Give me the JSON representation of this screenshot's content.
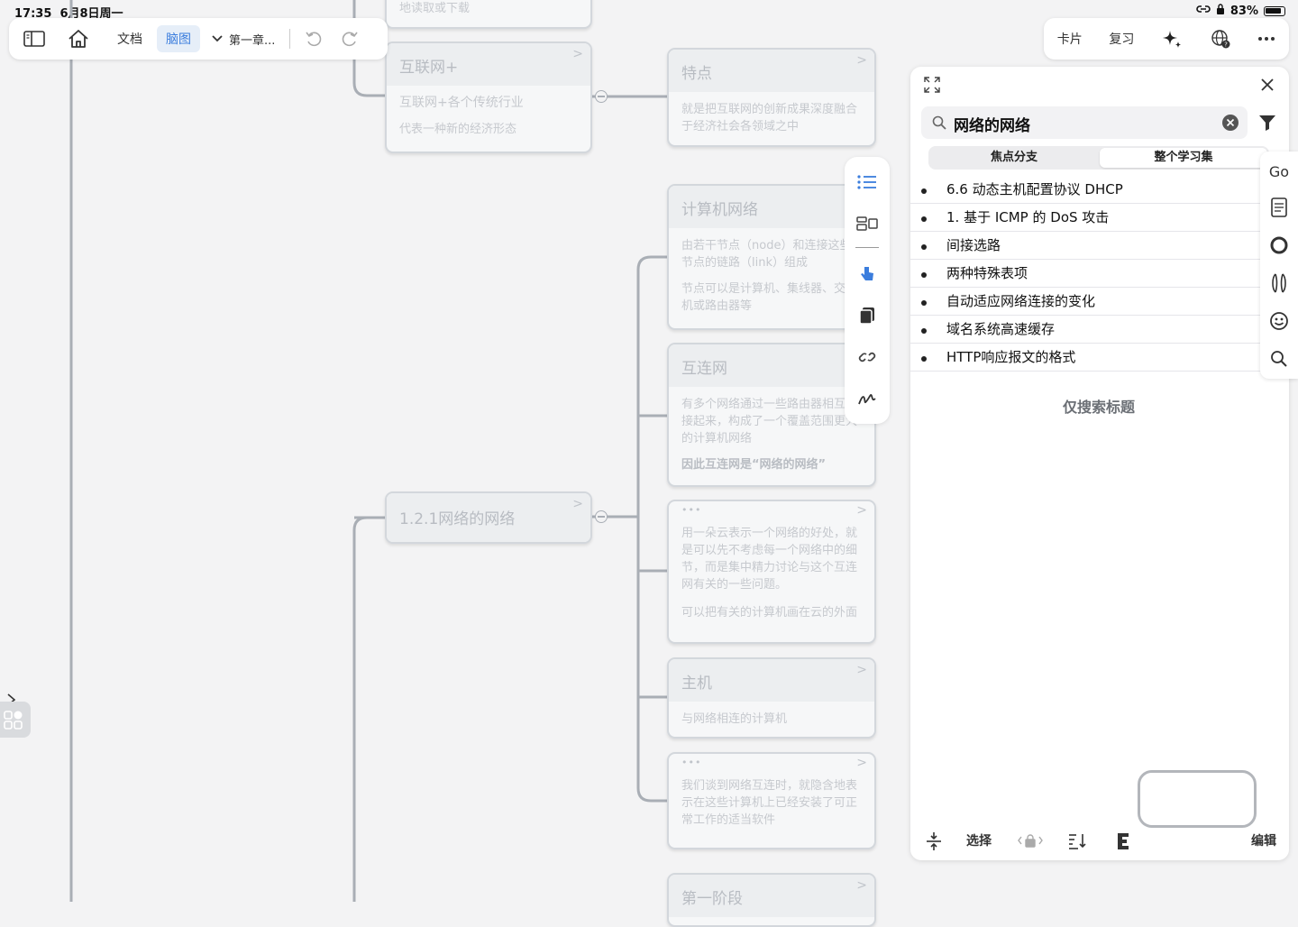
{
  "status": {
    "time": "17:35",
    "date": "6月8日周一",
    "battery": "83%"
  },
  "toolbar": {
    "doc_label": "文档",
    "mindmap_label": "脑图",
    "breadcrumb": "第一章..."
  },
  "toolbar_right": {
    "cards_label": "卡片",
    "review_label": "复习"
  },
  "mindmap": {
    "top_partial": "地读取或下载",
    "internet_plus": {
      "title": "互联网+",
      "line1": "互联网+各个传统行业",
      "line2": "代表一种新的经济形态"
    },
    "feature": {
      "title": "特点",
      "body": "就是把互联网的创新成果深度融合于经济社会各领域之中"
    },
    "net_of_net": {
      "title": "1.2.1网络的网络"
    },
    "computer_network": {
      "title": "计算机网络",
      "p1": "由若干节点（node）和连接这些节点的链路（link）组成",
      "p2": "节点可以是计算机、集线器、交换机或路由器等"
    },
    "internet": {
      "title": "互连网",
      "p1": "有多个网络通过一些路由器相互连接起来，构成了一个覆盖范围更大的计算机网络",
      "p2": "因此互连网是“网络的网络”"
    },
    "cloud": {
      "p1": "用一朵云表示一个网络的好处，就是可以先不考虑每一个网络中的细节，而是集中精力讨论与这个互连网有关的一些问题。",
      "p2": "可以把有关的计算机画在云的外面"
    },
    "host": {
      "title": "主机",
      "body": "与网络相连的计算机"
    },
    "interconnect": {
      "body": "我们谈到网络互连时，就隐含地表示在这些计算机上已经安装了可正常工作的适当软件"
    },
    "stage1": {
      "title": "第一阶段"
    }
  },
  "search_panel": {
    "query": "网络的网络",
    "segments": [
      "焦点分支",
      "整个学习集"
    ],
    "results": [
      "6.6 动态主机配置协议 DHCP",
      "1. 基于 ICMP 的 DoS 攻击",
      "间接选路",
      "两种特殊表项",
      "自动适应网络连接的变化",
      "域名系统高速缓存",
      "HTTP响应报文的格式"
    ],
    "only_titles": "仅搜索标题",
    "select_label": "选择",
    "edit_label": "编辑"
  },
  "edge_strip": {
    "go_label": "Go"
  },
  "colors": {
    "accent": "#3b7ddd",
    "node_border": "#d3d7dc",
    "line": "#a9aeb5"
  }
}
